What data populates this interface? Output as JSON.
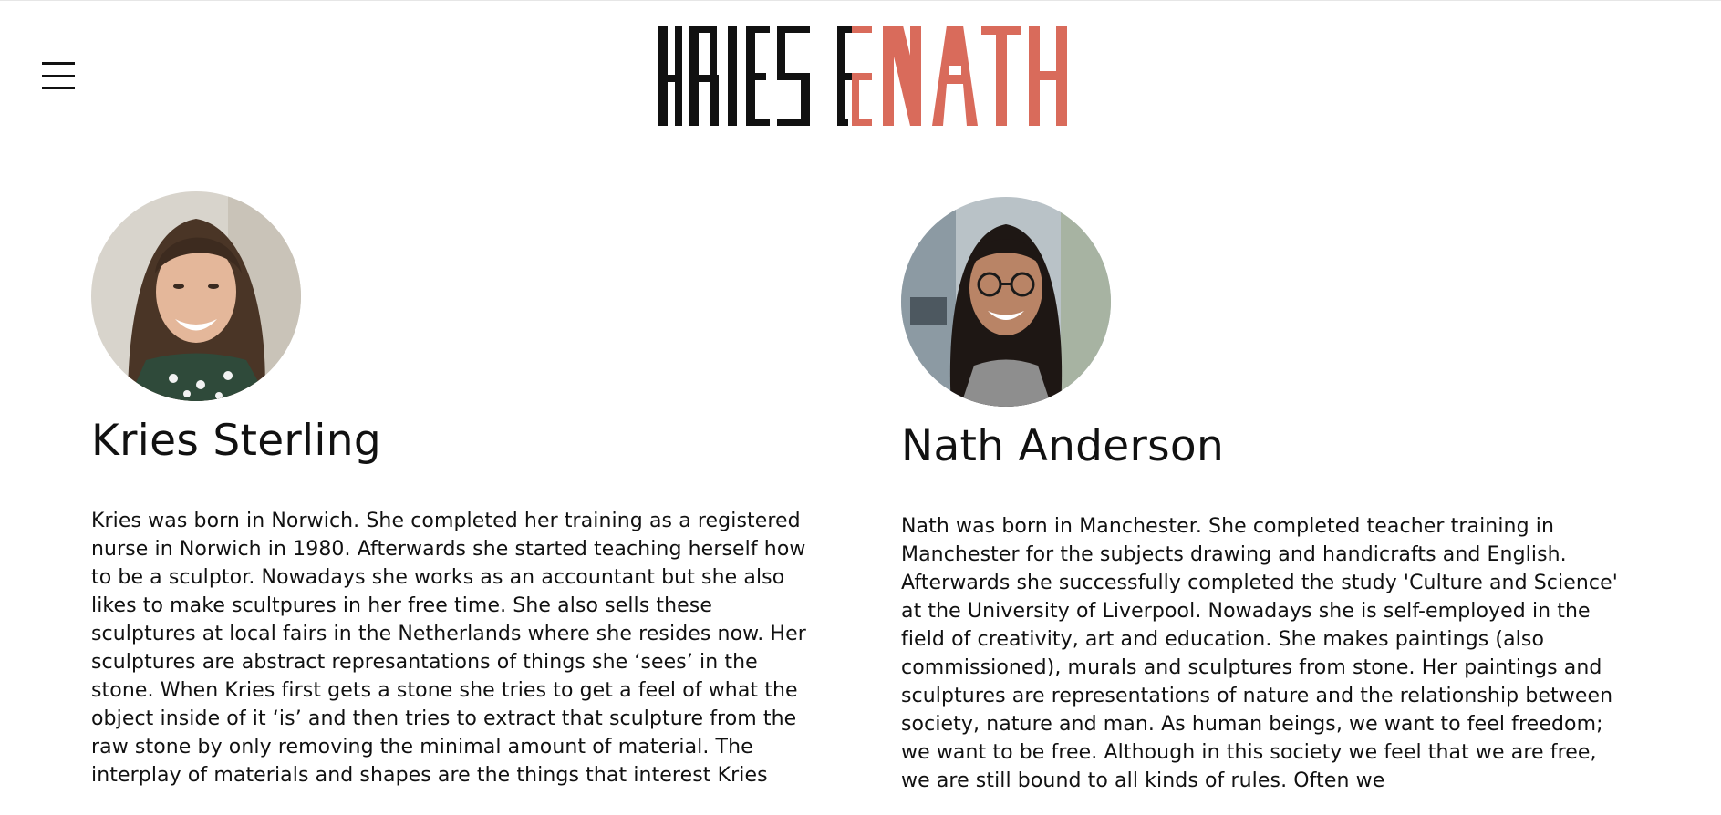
{
  "header": {
    "menu_icon": "hamburger-menu-icon",
    "logo_text": "KRIES & NATH",
    "logo_part1": "KRIES",
    "logo_amp": "&",
    "logo_part2": "NATH",
    "logo_accent_color": "#d96b5b"
  },
  "people": [
    {
      "name": "Kries Sterling",
      "bio": "Kries was born in Norwich. She completed her training as a registered nurse in Norwich in 1980. Afterwards she started teaching herself how to be a sculptor. Nowadays she works as an accountant but she also likes to make scultpures in her free time. She also sells these sculptures at local fairs in the Netherlands where she resides now. Her sculptures are abstract represantations of things she ‘sees’ in the stone. When Kries first gets a stone she tries to get a feel of what the object inside of it ‘is’ and then tries to extract that sculpture from the raw stone by only removing the minimal amount of material. The interplay of materials and shapes are the things that interest Kries"
    },
    {
      "name": "Nath Anderson",
      "bio": "Nath was born in Manchester. She completed teacher training in Manchester for the subjects drawing and handicrafts and English. Afterwards she successfully completed the study 'Culture and Science' at the University of Liverpool. Nowadays she is self-employed in the field of creativity, art and education. She makes paintings (also commissioned), murals and sculptures from stone. Her paintings and sculptures are representations of nature and the relationship between society, nature and man. As human beings, we want to feel freedom; we want to be free. Although in this society we feel that we are free, we are still bound to all kinds of rules. Often we"
    }
  ]
}
